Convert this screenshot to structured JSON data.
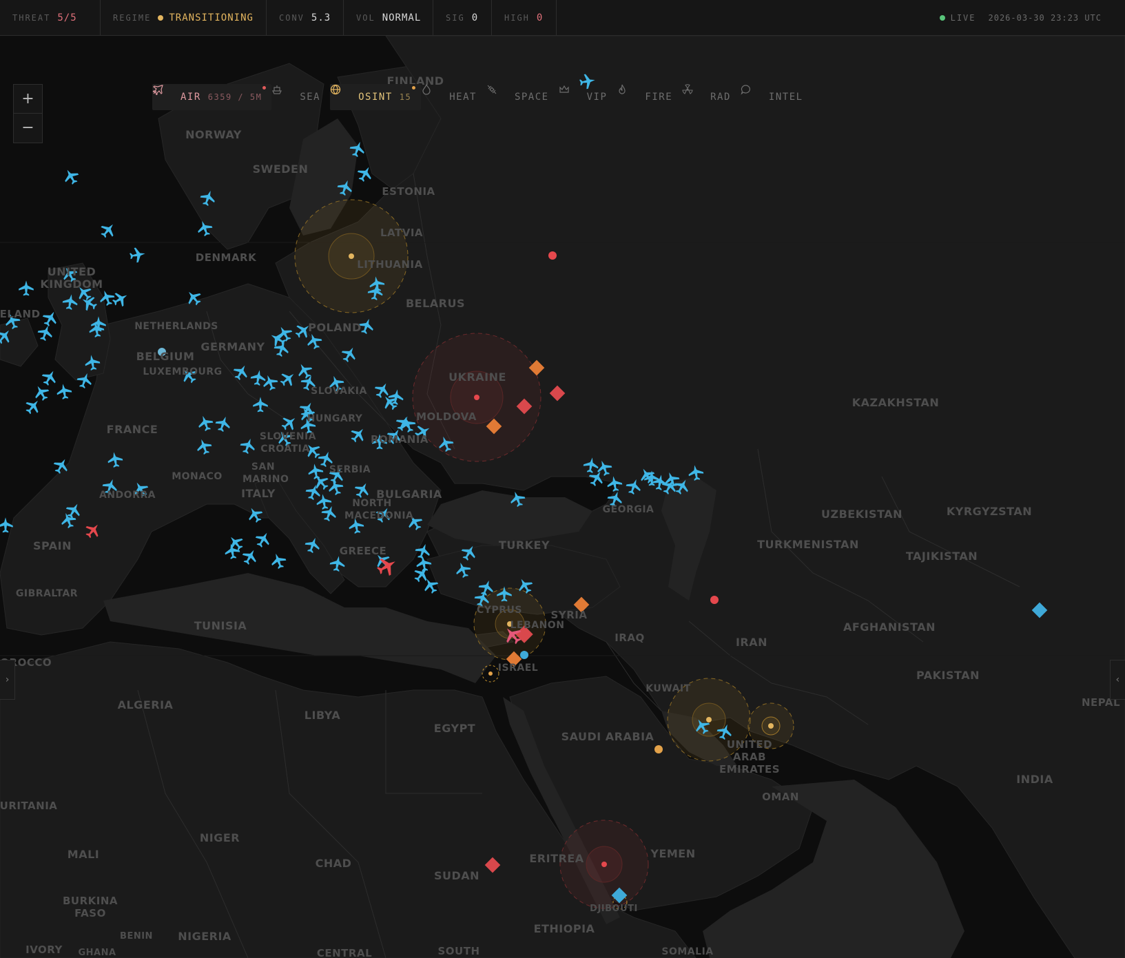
{
  "topbar": {
    "stats": [
      {
        "label": "THREAT",
        "value": "5/5",
        "color": "#e0707a"
      },
      {
        "label": "REGIME",
        "value": "TRANSITIONING",
        "color": "#e3b55f",
        "dot": true
      },
      {
        "label": "CONV",
        "value": "5.3",
        "color": "#d8d8d8"
      },
      {
        "label": "VOL",
        "value": "NORMAL",
        "color": "#d8d8d8"
      },
      {
        "label": "SIG",
        "value": "0",
        "color": "#d8d8d8"
      },
      {
        "label": "HIGH",
        "value": "0",
        "color": "#e0707a"
      }
    ],
    "live_label": "LIVE",
    "timestamp": "2026-03-30 23:23 UTC",
    "live_color": "#58c47a"
  },
  "zoom": {
    "in": "+",
    "out": "−"
  },
  "layers": [
    {
      "name": "AIR",
      "count": "6359 / 5M",
      "icon": "plane-icon",
      "active": true,
      "dot": "#e05a5a"
    },
    {
      "name": "SEA",
      "count": "",
      "icon": "ship-icon",
      "active": false
    },
    {
      "name": "OSINT",
      "count": "15",
      "icon": "globe-icon",
      "active": true,
      "dot": "#e3a24a"
    },
    {
      "name": "HEAT",
      "count": "",
      "icon": "flame-icon",
      "active": false
    },
    {
      "name": "SPACE",
      "count": "",
      "icon": "satellite-icon",
      "active": false
    },
    {
      "name": "VIP",
      "count": "",
      "icon": "crown-icon",
      "active": false
    },
    {
      "name": "FIRE",
      "count": "",
      "icon": "fire-icon",
      "active": false
    },
    {
      "name": "RAD",
      "count": "",
      "icon": "radiation-icon",
      "active": false
    },
    {
      "name": "INTEL",
      "count": "",
      "icon": "chat-icon",
      "active": false
    }
  ],
  "countries": [
    "FINLAND",
    "NORWAY",
    "SWEDEN",
    "ESTONIA",
    "LATVIA",
    "LITHUANIA",
    "DENMARK",
    "UNITED KINGDOM",
    "IRELAND",
    "NETHERLANDS",
    "BELGIUM",
    "LUXEMBOURG",
    "GERMANY",
    "POLAND",
    "BELARUS",
    "UKRAINE",
    "MOLDOVA",
    "SLOVAKIA",
    "HUNGARY",
    "ROMANIA",
    "FRANCE",
    "SLOVENIA",
    "CROATIA",
    "MONACO",
    "SAN MARINO",
    "ANDORRA",
    "ITALY",
    "SERBIA",
    "BULGARIA",
    "NORTH MACEDONIA",
    "GREECE",
    "TURKEY",
    "SPAIN",
    "GIBRALTAR",
    "TUNISIA",
    "MOROCCO",
    "ALGERIA",
    "LIBYA",
    "EGYPT",
    "CYPRUS",
    "LEBANON",
    "SYRIA",
    "ISRAEL",
    "IRAQ",
    "IRAN",
    "KUWAIT",
    "SAUDI ARABIA",
    "UNITED ARAB EMIRATES",
    "OMAN",
    "YEMEN",
    "ERITREA",
    "DJIBOUTI",
    "ETHIOPIA",
    "SUDAN",
    "CHAD",
    "NIGER",
    "MALI",
    "MAURITANIA",
    "BURKINA FASO",
    "NIGERIA",
    "BENIN",
    "GHANA",
    "IVORY",
    "CENTRAL",
    "SOUTH",
    "SOMALIA",
    "KAZAKHSTAN",
    "UZBEKISTAN",
    "KYRGYZSTAN",
    "TURKMENISTAN",
    "TAJIKISTAN",
    "AFGHANISTAN",
    "PAKISTAN",
    "INDIA",
    "NEPAL",
    "GEORGIA"
  ],
  "colors": {
    "aircraft": "#3fb6e6",
    "hostile": "#e5484d",
    "warning": "#e07a35",
    "zone_amber": "#c9962f",
    "osint_blue": "#3fa9d8"
  }
}
